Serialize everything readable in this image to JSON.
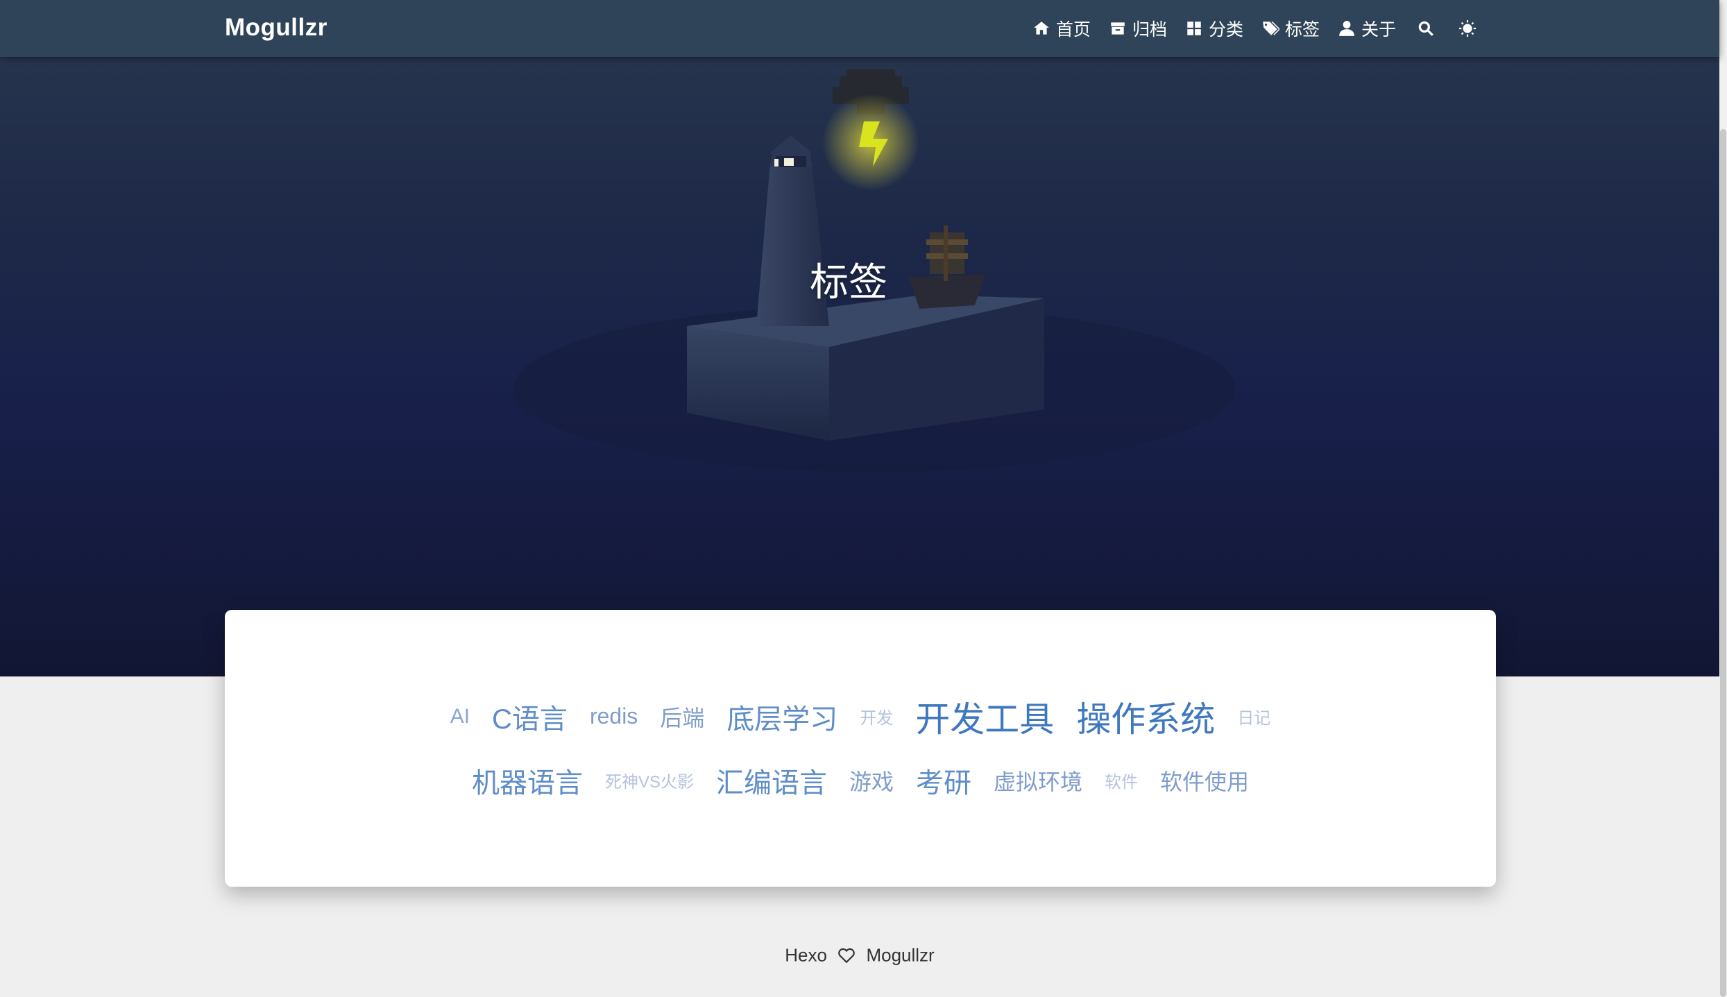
{
  "site": {
    "brand": "Mogullzr"
  },
  "nav": {
    "items": [
      {
        "label": "首页",
        "icon": "home-icon"
      },
      {
        "label": "归档",
        "icon": "archive-icon"
      },
      {
        "label": "分类",
        "icon": "grid-icon"
      },
      {
        "label": "标签",
        "icon": "tags-icon"
      },
      {
        "label": "关于",
        "icon": "user-icon"
      }
    ],
    "search_icon": "search-icon",
    "theme_icon": "sun-icon"
  },
  "hero": {
    "title": "标签"
  },
  "tags": {
    "row1": [
      {
        "label": "AI",
        "size": 30,
        "color": "#8aa6d4"
      },
      {
        "label": "C语言",
        "size": 40,
        "color": "#5f8dc8"
      },
      {
        "label": "redis",
        "size": 32,
        "color": "#7f9dcc"
      },
      {
        "label": "后端",
        "size": 32,
        "color": "#7f9dcc"
      },
      {
        "label": "底层学习",
        "size": 40,
        "color": "#5f8dc8"
      },
      {
        "label": "开发",
        "size": 24,
        "color": "#b5c2e0"
      },
      {
        "label": "开发工具",
        "size": 50,
        "color": "#3f78bd"
      },
      {
        "label": "操作系统",
        "size": 50,
        "color": "#3f78bd"
      },
      {
        "label": "日记",
        "size": 24,
        "color": "#b5c2e0"
      }
    ],
    "row2": [
      {
        "label": "机器语言",
        "size": 40,
        "color": "#5f8dc8"
      },
      {
        "label": "死神VS火影",
        "size": 24,
        "color": "#b5c2e0"
      },
      {
        "label": "汇编语言",
        "size": 40,
        "color": "#5f8dc8"
      },
      {
        "label": "游戏",
        "size": 32,
        "color": "#7f9dcc"
      },
      {
        "label": "考研",
        "size": 40,
        "color": "#5f8dc8"
      },
      {
        "label": "虚拟环境",
        "size": 32,
        "color": "#7f9dcc"
      },
      {
        "label": "软件",
        "size": 24,
        "color": "#b5c2e0"
      },
      {
        "label": "软件使用",
        "size": 32,
        "color": "#7f9dcc"
      }
    ]
  },
  "footer": {
    "left": "Hexo",
    "icon": "heart-icon",
    "right": "Mogullzr"
  }
}
